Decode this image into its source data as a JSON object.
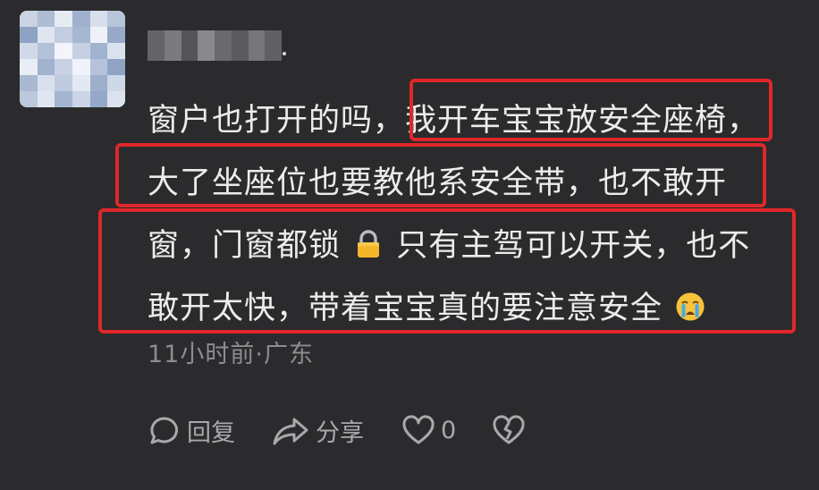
{
  "comment": {
    "lines": [
      "窗户也打开的吗，我开车宝宝放安全座椅，",
      "大了坐座位也要教他系安全带，也不敢开",
      "窗，门窗都锁",
      "只有主驾可以开关，也不",
      "敢开太快，带着宝宝真的要注意安全"
    ],
    "emoji_lock": "lock-emoji",
    "emoji_cry": "crying-face-emoji"
  },
  "meta": {
    "time_location": "11小时前·广东"
  },
  "actions": {
    "reply_label": "回复",
    "share_label": "分享",
    "like_count": "0"
  },
  "colors": {
    "background": "#2b2b2d",
    "text": "#ececec",
    "muted": "#8d8d90",
    "highlight_border": "#e1262a"
  }
}
